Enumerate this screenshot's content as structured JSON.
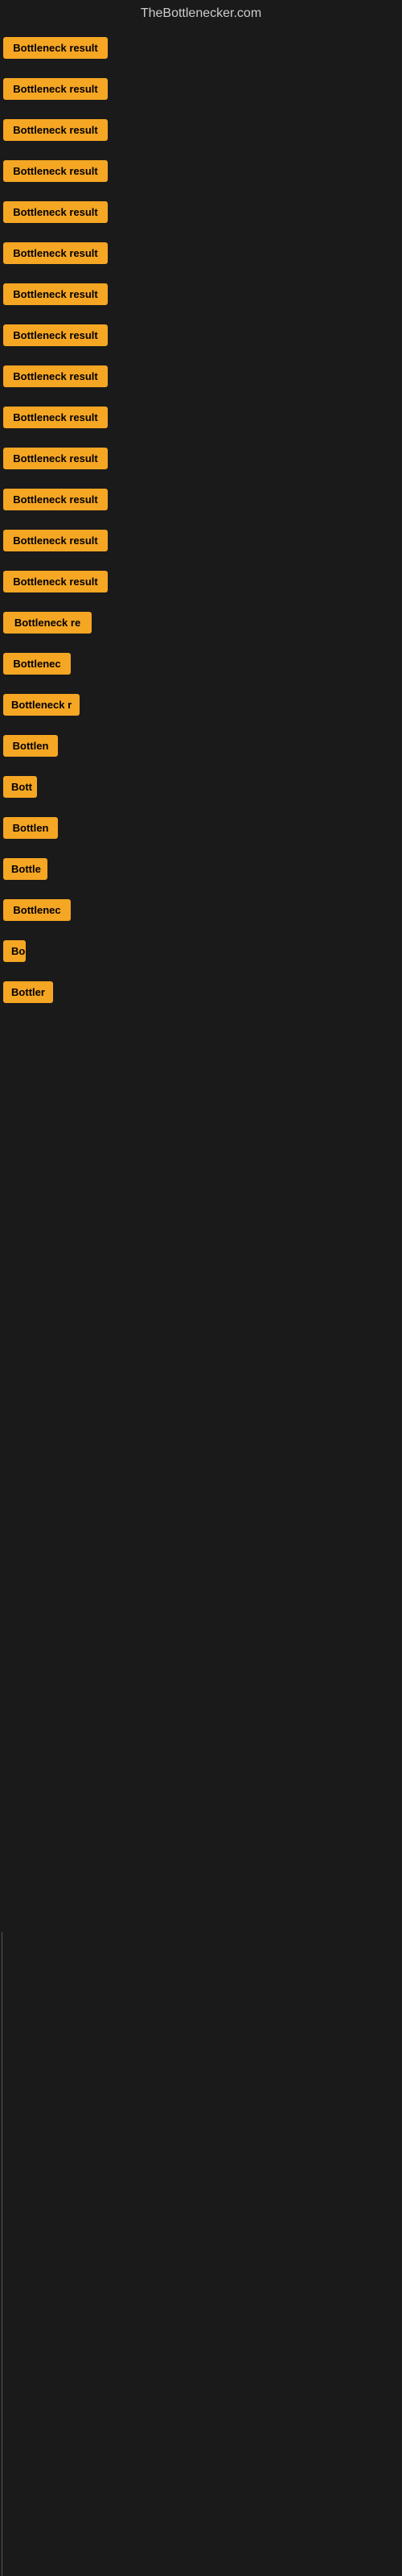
{
  "site": {
    "title": "TheBottlenecker.com"
  },
  "buttons": [
    {
      "id": 1,
      "label": "Bottleneck result",
      "width": 130
    },
    {
      "id": 2,
      "label": "Bottleneck result",
      "width": 130
    },
    {
      "id": 3,
      "label": "Bottleneck result",
      "width": 130
    },
    {
      "id": 4,
      "label": "Bottleneck result",
      "width": 130
    },
    {
      "id": 5,
      "label": "Bottleneck result",
      "width": 130
    },
    {
      "id": 6,
      "label": "Bottleneck result",
      "width": 130
    },
    {
      "id": 7,
      "label": "Bottleneck result",
      "width": 130
    },
    {
      "id": 8,
      "label": "Bottleneck result",
      "width": 130
    },
    {
      "id": 9,
      "label": "Bottleneck result",
      "width": 130
    },
    {
      "id": 10,
      "label": "Bottleneck result",
      "width": 130
    },
    {
      "id": 11,
      "label": "Bottleneck result",
      "width": 130
    },
    {
      "id": 12,
      "label": "Bottleneck result",
      "width": 130
    },
    {
      "id": 13,
      "label": "Bottleneck result",
      "width": 130
    },
    {
      "id": 14,
      "label": "Bottleneck result",
      "width": 130
    },
    {
      "id": 15,
      "label": "Bottleneck re",
      "width": 110
    },
    {
      "id": 16,
      "label": "Bottlenec",
      "width": 84
    },
    {
      "id": 17,
      "label": "Bottleneck r",
      "width": 95
    },
    {
      "id": 18,
      "label": "Bottlen",
      "width": 68
    },
    {
      "id": 19,
      "label": "Bott",
      "width": 42
    },
    {
      "id": 20,
      "label": "Bottlen",
      "width": 68
    },
    {
      "id": 21,
      "label": "Bottle",
      "width": 55
    },
    {
      "id": 22,
      "label": "Bottlenec",
      "width": 84
    },
    {
      "id": 23,
      "label": "Bo",
      "width": 28
    },
    {
      "id": 24,
      "label": "Bottler",
      "width": 62
    }
  ],
  "colors": {
    "button_bg": "#f5a623",
    "button_text": "#000000",
    "background": "#1a1a1a",
    "title_text": "#cccccc"
  }
}
